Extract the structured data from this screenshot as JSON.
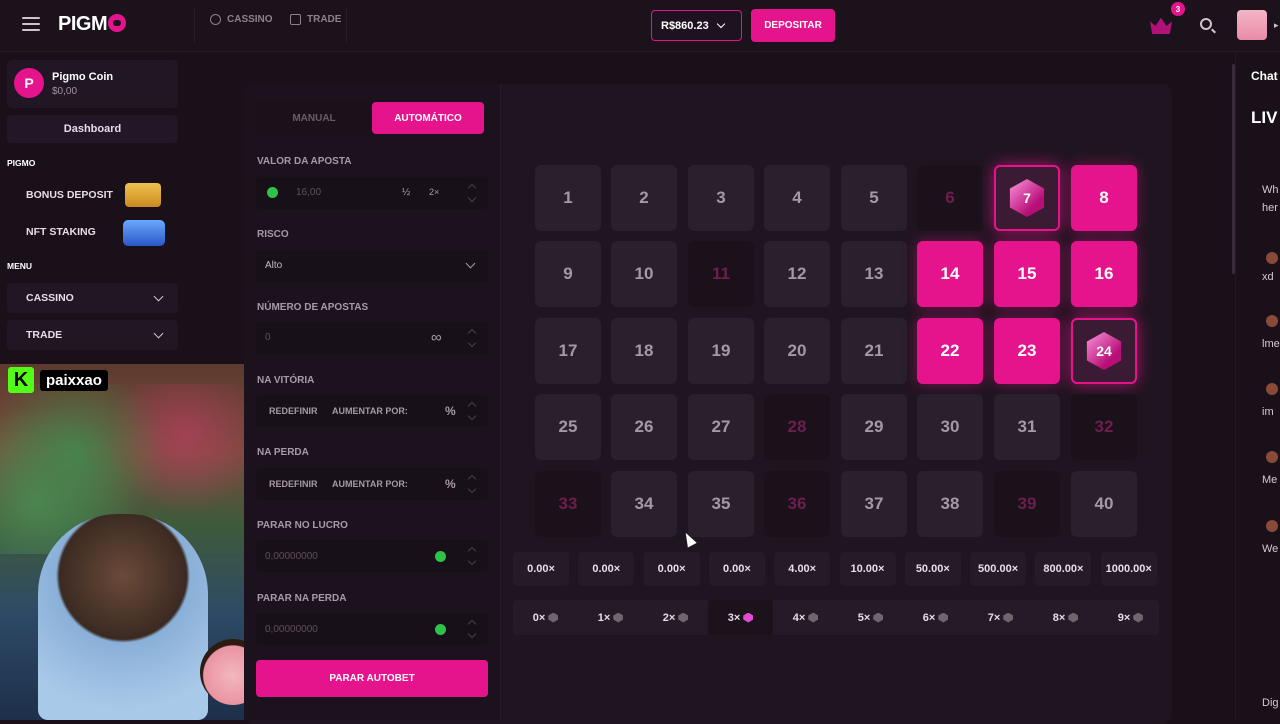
{
  "header": {
    "logo": "PIGM",
    "nav": [
      {
        "label": "CASSINO",
        "icon": "casino-icon"
      },
      {
        "label": "TRADE",
        "icon": "trade-icon"
      }
    ],
    "balance": "R$860.23",
    "deposit": "DEPOSITAR",
    "notifications": "3"
  },
  "sidebar": {
    "coin_name": "Pigmo Coin",
    "coin_value": "$0,00",
    "coin_logo": "P",
    "dashboard": "Dashboard",
    "section_pigmo": "PIGMO",
    "bonus_deposit": "BONUS DEPOSIT",
    "nft_staking": "NFT STAKING",
    "section_menu": "MENU",
    "cassino": "CASSINO",
    "trade": "TRADE"
  },
  "stream": {
    "channel": "paixxao",
    "platform_logo": "K"
  },
  "game": {
    "tab_manual": "MANUAL",
    "tab_auto": "AUTOMÁTICO",
    "bet_label": "VALOR DA APOSTA",
    "bet_value": "16,00",
    "half": "½",
    "double": "2×",
    "risk_label": "RISCO",
    "risk_value": "Alto",
    "num_bets_label": "NÚMERO DE APOSTAS",
    "num_bets_value": "0",
    "infinity": "∞",
    "on_win_label": "NA VITÓRIA",
    "on_loss_label": "NA PERDA",
    "reset": "REDEFINIR",
    "increase": "AUMENTAR POR:",
    "percent": "%",
    "stop_profit_label": "PARAR NO LUCRO",
    "stop_profit_value": "0,00000000",
    "stop_loss_label": "PARAR NA PERDA",
    "stop_loss_value": "0,00000000",
    "stop_autobet": "PARAR AUTOBET"
  },
  "board": {
    "tiles": [
      {
        "n": "1",
        "state": "normal"
      },
      {
        "n": "2",
        "state": "normal"
      },
      {
        "n": "3",
        "state": "normal"
      },
      {
        "n": "4",
        "state": "normal"
      },
      {
        "n": "5",
        "state": "normal"
      },
      {
        "n": "6",
        "state": "dim"
      },
      {
        "n": "7",
        "state": "hit-alt"
      },
      {
        "n": "8",
        "state": "selected"
      },
      {
        "n": "9",
        "state": "normal"
      },
      {
        "n": "10",
        "state": "normal"
      },
      {
        "n": "11",
        "state": "dim"
      },
      {
        "n": "12",
        "state": "normal"
      },
      {
        "n": "13",
        "state": "normal"
      },
      {
        "n": "14",
        "state": "selected"
      },
      {
        "n": "15",
        "state": "selected"
      },
      {
        "n": "16",
        "state": "selected"
      },
      {
        "n": "17",
        "state": "normal"
      },
      {
        "n": "18",
        "state": "normal"
      },
      {
        "n": "19",
        "state": "normal"
      },
      {
        "n": "20",
        "state": "normal"
      },
      {
        "n": "21",
        "state": "normal"
      },
      {
        "n": "22",
        "state": "selected"
      },
      {
        "n": "23",
        "state": "selected"
      },
      {
        "n": "24",
        "state": "hit-alt"
      },
      {
        "n": "25",
        "state": "normal"
      },
      {
        "n": "26",
        "state": "normal"
      },
      {
        "n": "27",
        "state": "normal"
      },
      {
        "n": "28",
        "state": "dim"
      },
      {
        "n": "29",
        "state": "normal"
      },
      {
        "n": "30",
        "state": "normal"
      },
      {
        "n": "31",
        "state": "normal"
      },
      {
        "n": "32",
        "state": "dim"
      },
      {
        "n": "33",
        "state": "dim"
      },
      {
        "n": "34",
        "state": "normal"
      },
      {
        "n": "35",
        "state": "normal"
      },
      {
        "n": "36",
        "state": "dim"
      },
      {
        "n": "37",
        "state": "normal"
      },
      {
        "n": "38",
        "state": "normal"
      },
      {
        "n": "39",
        "state": "dim"
      },
      {
        "n": "40",
        "state": "normal"
      }
    ],
    "multipliers": [
      "0.00×",
      "0.00×",
      "0.00×",
      "0.00×",
      "4.00×",
      "10.00×",
      "50.00×",
      "500.00×",
      "800.00×",
      "1000.00×"
    ],
    "hits": [
      "0×",
      "1×",
      "2×",
      "3×",
      "4×",
      "5×",
      "6×",
      "7×",
      "8×",
      "9×"
    ],
    "active_hit": "3×"
  },
  "chat": {
    "title": "Chat",
    "live": "LIV",
    "lines": [
      "Wh",
      "her",
      "xd",
      "lme",
      "im",
      "Me",
      "We",
      "Dig"
    ]
  },
  "colors": {
    "accent": "#e6148c",
    "bg": "#1a1019"
  }
}
